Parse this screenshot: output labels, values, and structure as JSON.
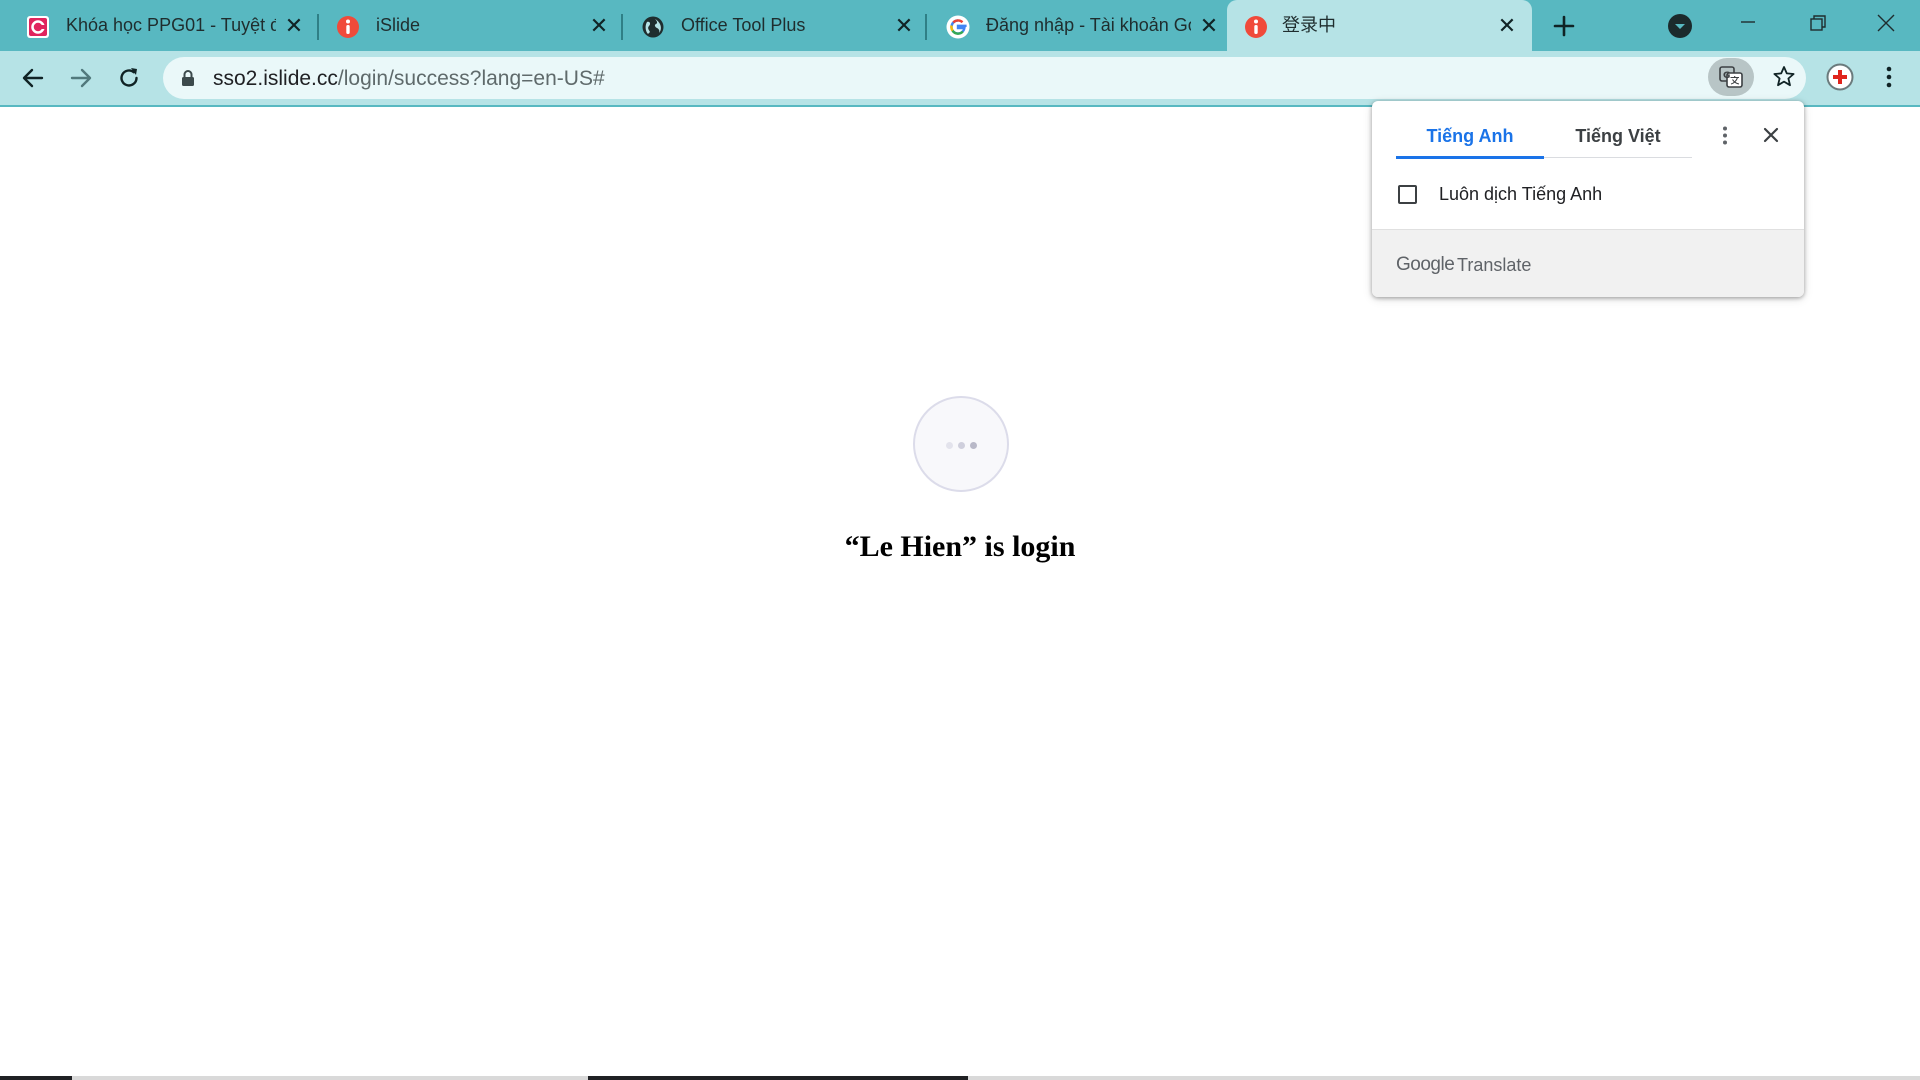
{
  "browser": {
    "tabs": [
      {
        "title": "Khóa học PPG01 - Tuyệt đ",
        "icon": "ppg-logo-icon",
        "active": false
      },
      {
        "title": "iSlide",
        "icon": "islide-icon",
        "active": false
      },
      {
        "title": "Office Tool Plus",
        "icon": "globe-icon",
        "active": false
      },
      {
        "title": "Đăng nhập - Tài khoản Go",
        "icon": "google-g-icon",
        "active": false
      },
      {
        "title": "登录中",
        "icon": "islide-icon",
        "active": true
      }
    ],
    "address": {
      "host": "sso2.islide.cc",
      "path": "/login/success?lang=en-US#"
    },
    "colors": {
      "tabstrip": "#58b8c1",
      "active_tab": "#b6e3e6",
      "accent": "#1a73e8"
    }
  },
  "page": {
    "message": "“Le Hien” is login"
  },
  "translate_popup": {
    "tab_source": "Tiếng Anh",
    "tab_target": "Tiếng Việt",
    "always_translate_label": "Luôn dịch Tiếng Anh",
    "always_translate_checked": false,
    "footer_brand": "Google",
    "footer_product": "Translate"
  }
}
